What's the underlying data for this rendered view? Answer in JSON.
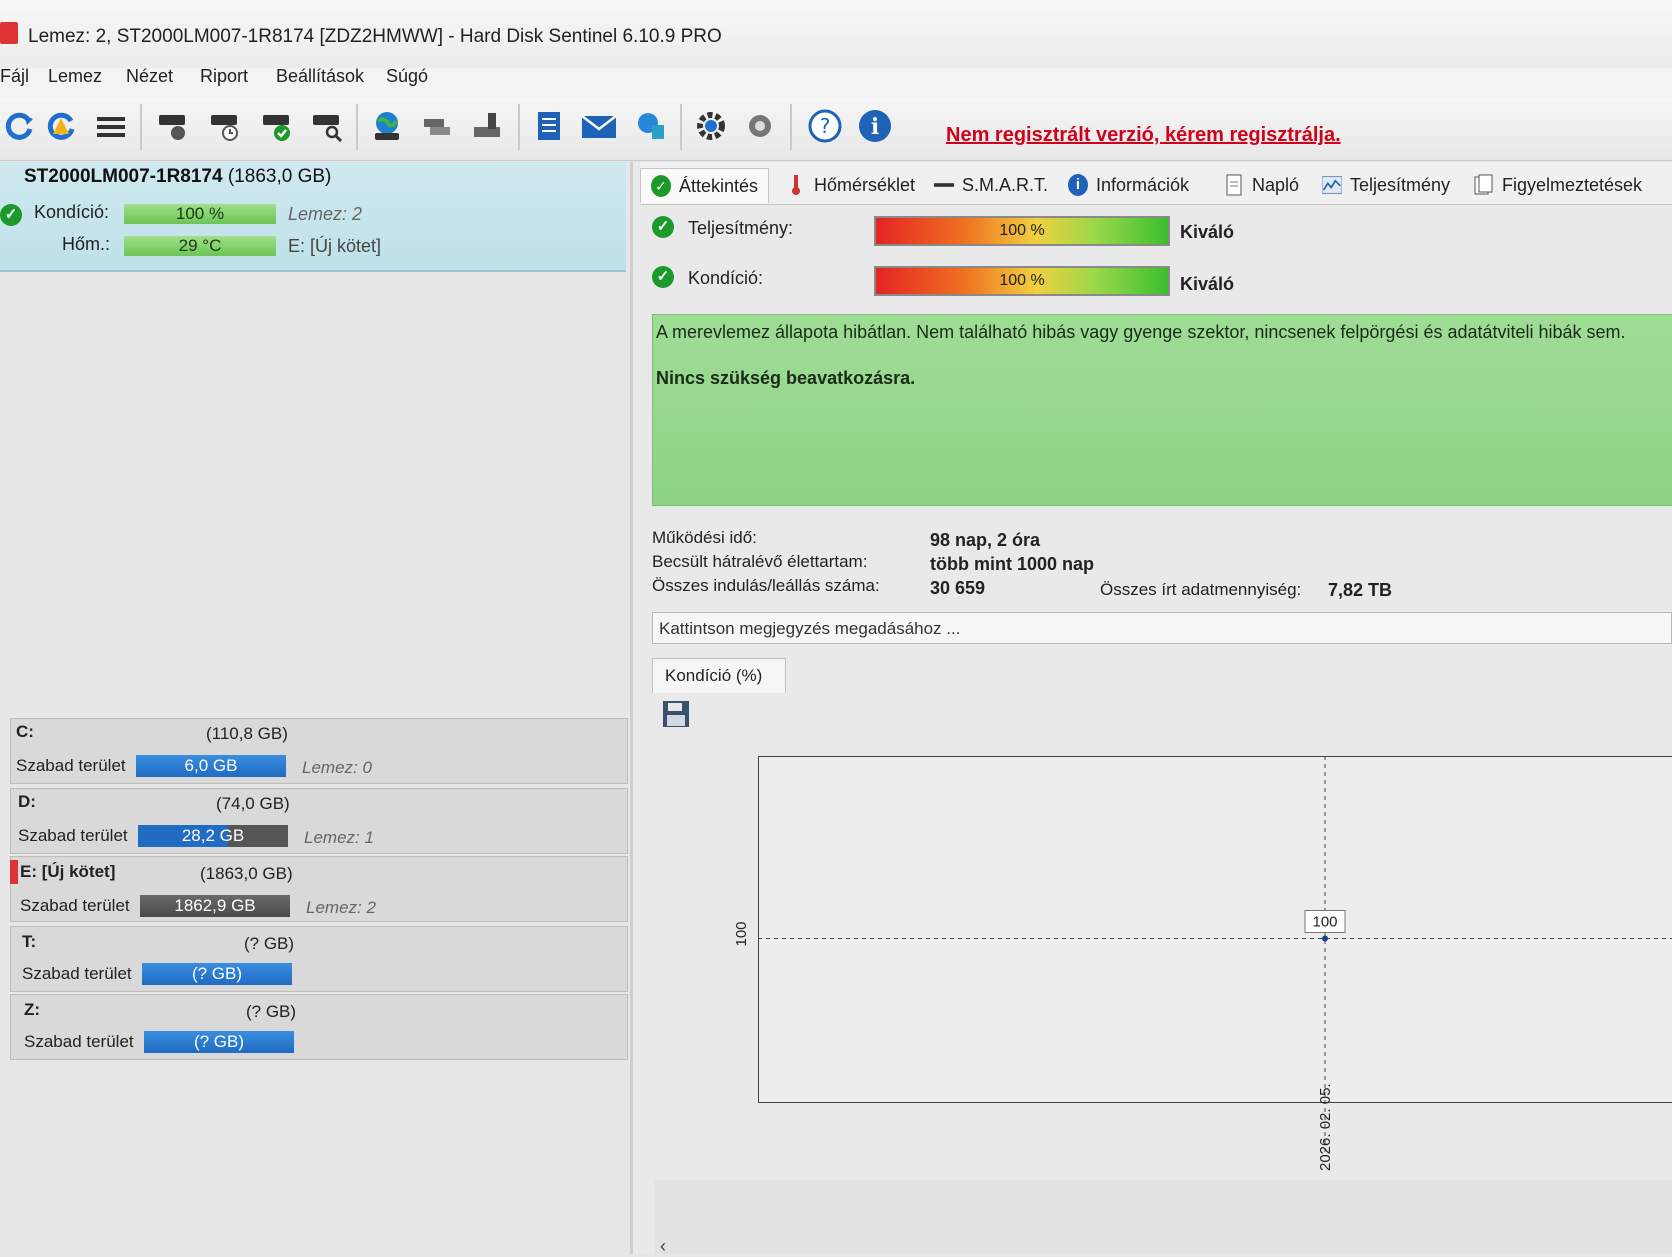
{
  "window": {
    "title": "Lemez: 2, ST2000LM007-1R8174 [ZDZ2HMWW]  -  Hard Disk Sentinel 6.10.9 PRO"
  },
  "menu": [
    "Fájl",
    "Lemez",
    "Nézet",
    "Riport",
    "Beállítások",
    "Súgó"
  ],
  "toolbar": {
    "icons": [
      "refresh-icon",
      "refresh-alert-icon",
      "drive-list-icon",
      "disk-test-icon",
      "disk-schedule-icon",
      "disk-check-icon",
      "disk-search-icon",
      "globe-disk-icon",
      "backup-icon",
      "tools-icon",
      "report-icon",
      "email-icon",
      "network-icon",
      "settings-gear-icon",
      "sound-icon",
      "help-icon",
      "info-icon"
    ],
    "register_link": "Nem regisztrált verzió, kérem regisztrálja."
  },
  "disk": {
    "model": "ST2000LM007-1R8174",
    "size": "(1863,0 GB)",
    "condition_label": "Kondíció:",
    "condition_value": "100 %",
    "condition_pct": 100,
    "disk_label": "Lemez: 2",
    "temp_label": "Hőm.:",
    "temp_value": "29 °C",
    "volume_label": "E: [Új kötet]"
  },
  "volumes": [
    {
      "name": "C:",
      "size": "(110,8 GB)",
      "free_label": "Szabad terület",
      "free": "6,0 GB",
      "disk": "Lemez: 0",
      "style": "blue"
    },
    {
      "name": "D:",
      "size": "(74,0 GB)",
      "free_label": "Szabad terület",
      "free": "28,2 GB",
      "disk": "Lemez: 1",
      "style": "blue"
    },
    {
      "name": "E: [Új kötet]",
      "size": "(1863,0 GB)",
      "free_label": "Szabad terület",
      "free": "1862,9 GB",
      "disk": "Lemez: 2",
      "style": "dark"
    },
    {
      "name": "T:",
      "size": "(? GB)",
      "free_label": "Szabad terület",
      "free": "(? GB)",
      "disk": "",
      "style": "blue"
    },
    {
      "name": "Z:",
      "size": "(? GB)",
      "free_label": "Szabad terület",
      "free": "(? GB)",
      "disk": "",
      "style": "blue"
    }
  ],
  "tabs": [
    {
      "label": "Áttekintés",
      "icon": "check-circle-icon"
    },
    {
      "label": "Hőmérséklet",
      "icon": "thermometer-icon"
    },
    {
      "label": "S.M.A.R.T.",
      "icon": "minus-icon"
    },
    {
      "label": "Információk",
      "icon": "info-icon"
    },
    {
      "label": "Napló",
      "icon": "document-icon"
    },
    {
      "label": "Teljesítmény",
      "icon": "performance-chart-icon"
    },
    {
      "label": "Figyelmeztetések",
      "icon": "alerts-icon"
    }
  ],
  "overview": {
    "performance_label": "Teljesítmény:",
    "performance_value": "100 %",
    "performance_rating": "Kiváló",
    "condition_label": "Kondíció:",
    "condition_value": "100 %",
    "condition_rating": "Kiváló",
    "message_line1": "A merevlemez állapota hibátlan. Nem található hibás vagy gyenge szektor, nincsenek felpörgési és adatátviteli hibák sem.",
    "message_line2": "Nincs szükség beavatkozásra.",
    "uptime_label": "Működési idő:",
    "uptime_value": "98 nap, 2 óra",
    "remaining_label": "Becsült hátralévő élettartam:",
    "remaining_value": "több mint 1000 nap",
    "starts_label": "Összes indulás/leállás száma:",
    "starts_value": "30 659",
    "written_label": "Összes írt adatmennyiség:",
    "written_value": "7,82 TB",
    "note_placeholder": "Kattintson megjegyzés megadásához ...",
    "subtab_label": "Kondíció  (%)"
  },
  "chart_data": {
    "type": "line",
    "title": "",
    "x": [
      "2026. 02. 05."
    ],
    "series": [
      {
        "values": [
          100
        ]
      }
    ],
    "y_tick_label": "100",
    "point_label": "100"
  },
  "colors": {
    "accent_ok": "#1b9a2a",
    "volume_blue": "#1f6cc2",
    "message_bg": "#9fdc96",
    "register_red": "#d0021b"
  }
}
